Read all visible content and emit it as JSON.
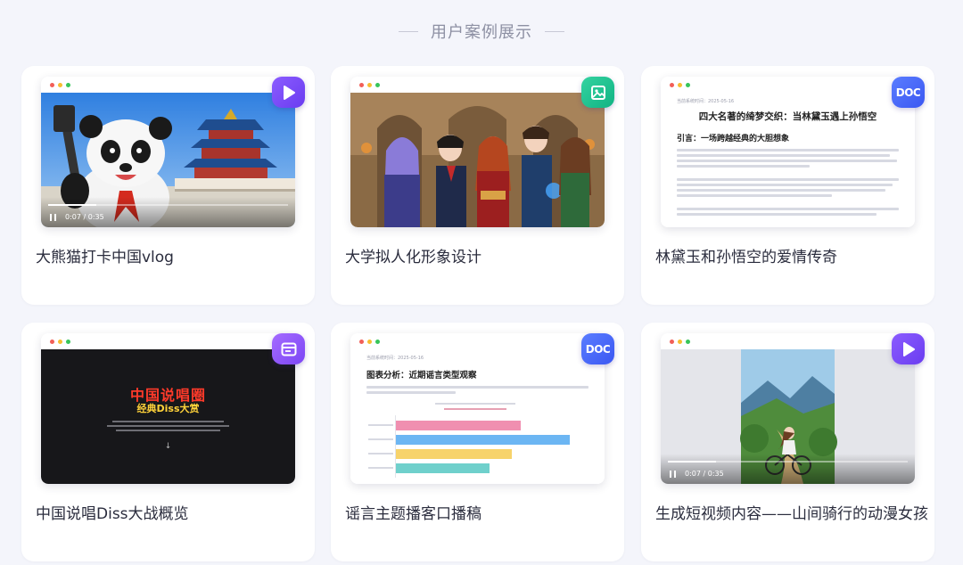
{
  "section": {
    "title": "用户案例展示"
  },
  "cards": [
    {
      "title": "大熊猫打卡中国vlog",
      "badge": "play-icon",
      "time": "0:07 / 0:35",
      "progress": 0.2
    },
    {
      "title": "大学拟人化形象设计",
      "badge": "image-icon"
    },
    {
      "title": "林黛玉和孙悟空的爱情传奇",
      "badge_label": "DOC",
      "doc": {
        "meta": "当前系统时间：2025-05-16",
        "heading": "四大名著的绮梦交织：当林黛玉遇上孙悟空",
        "subheading": "引言：一场跨越经典的大胆想象"
      }
    },
    {
      "title": "中国说唱Diss大战概览",
      "badge": "browser-icon",
      "poster": {
        "main": "中国说唱圈",
        "sub": "经典Diss大赏"
      }
    },
    {
      "title": "谣言主题播客口播稿",
      "badge_label": "DOC",
      "doc": {
        "meta": "当前系统时间：2025-05-16",
        "heading": "图表分析：近期谣言类型观察"
      }
    },
    {
      "title": "生成短视频内容——山间骑行的动漫女孩",
      "badge": "play-icon",
      "time": "0:07 / 0:35",
      "progress": 0.2
    }
  ],
  "colors": {
    "video": "#7a48f7",
    "image": "#1bbf8e",
    "doc": "#4a68f7",
    "web": "#9257fa"
  }
}
